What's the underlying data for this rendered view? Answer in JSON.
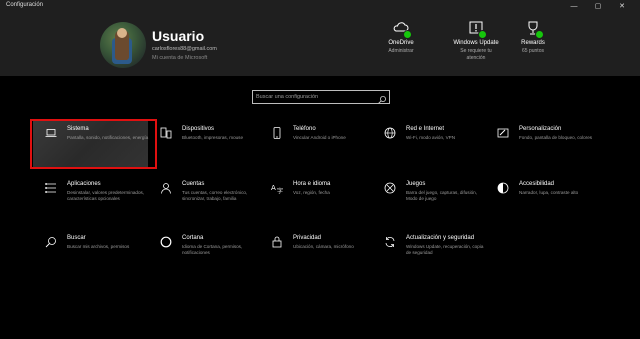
{
  "window": {
    "title": "Configuración",
    "controls": {
      "minimize": "—",
      "maximize": "▢",
      "close": "✕"
    }
  },
  "user": {
    "name": "Usuario",
    "email": "carlosflores88@gmail.com",
    "account_link": "Mi cuenta de Microsoft"
  },
  "status": [
    {
      "id": "onedrive",
      "title": "OneDrive",
      "sub": "Administrar",
      "icon": "cloud-icon"
    },
    {
      "id": "windows-update",
      "title": "Windows Update",
      "sub": "Se requiere tu atención",
      "icon": "update-icon"
    },
    {
      "id": "rewards",
      "title": "Rewards",
      "sub": "65 puntos",
      "icon": "trophy-icon"
    }
  ],
  "search": {
    "placeholder": "Buscar una configuración"
  },
  "categories": [
    {
      "title": "Sistema",
      "desc": "Pantalla, sonido, notificaciones, energía",
      "icon": "laptop-icon"
    },
    {
      "title": "Dispositivos",
      "desc": "Bluetooth, impresoras, mouse",
      "icon": "devices-icon"
    },
    {
      "title": "Teléfono",
      "desc": "Vincular Android o iPhone",
      "icon": "phone-icon"
    },
    {
      "title": "Red e Internet",
      "desc": "Wi-Fi, modo avión, VPN",
      "icon": "globe-icon"
    },
    {
      "title": "Personalización",
      "desc": "Fondo, pantalla de bloqueo, colores",
      "icon": "paint-icon"
    },
    {
      "title": "Aplicaciones",
      "desc": "Desinstalar, valores predeterminados, características opcionales",
      "icon": "apps-icon"
    },
    {
      "title": "Cuentas",
      "desc": "Tus cuentas, correo electrónico, sincronizar, trabajo, familia",
      "icon": "person-icon"
    },
    {
      "title": "Hora e idioma",
      "desc": "Voz, región, fecha",
      "icon": "time-language-icon"
    },
    {
      "title": "Juegos",
      "desc": "Barra del juego, capturas, difusión, Modo de juego",
      "icon": "xbox-icon"
    },
    {
      "title": "Accesibilidad",
      "desc": "Narrador, lupa, contraste alto",
      "icon": "accessibility-icon"
    },
    {
      "title": "Buscar",
      "desc": "Buscar mis archivos, permisos",
      "icon": "search-icon"
    },
    {
      "title": "Cortana",
      "desc": "Idioma de Cortana, permisos, notificaciones",
      "icon": "cortana-icon"
    },
    {
      "title": "Privacidad",
      "desc": "Ubicación, cámara, micrófono",
      "icon": "lock-icon"
    },
    {
      "title": "Actualización y seguridad",
      "desc": "Windows Update, recuperación, copia de seguridad",
      "icon": "sync-icon"
    }
  ],
  "colors": {
    "badge": "#16c60c",
    "highlight": "#e01010"
  }
}
